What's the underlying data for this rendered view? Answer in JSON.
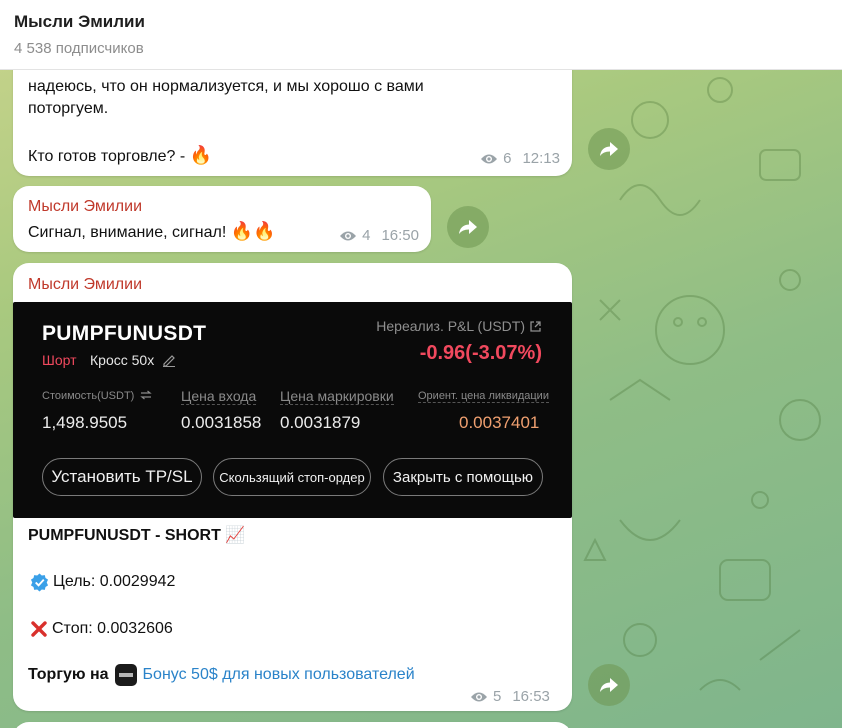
{
  "header": {
    "title": "Мысли Эмилии",
    "subscribers": "4 538 подписчиков"
  },
  "messages": [
    {
      "text_line1": "надеюсь, что он нормализуется, и мы хорошо с вами",
      "text_line2": "поторгуем.",
      "text_line3": "Кто готов торговле? -",
      "emoji": "🔥",
      "views": "6",
      "time": "12:13"
    },
    {
      "sender": "Мысли Эмилии",
      "text": "Сигнал, внимание, сигнал!",
      "emoji": "🔥🔥",
      "views": "4",
      "time": "16:50"
    },
    {
      "sender": "Мысли Эмилии",
      "card": {
        "pair": "PUMPFUNUSDT",
        "direction": "Шорт",
        "mode": "Кросс 50x",
        "pnl_label": "Нереализ. P&L (USDT)",
        "pnl_value": "-0.96(-3.07%)",
        "cost_label": "Стоимость(USDT)",
        "cost_value": "1,498.9505",
        "entry_label": "Цена входа",
        "entry_value": "0.0031858",
        "mark_label": "Цена маркировки",
        "mark_value": "0.0031879",
        "liq_label": "Ориент. цена ликвидации",
        "liq_value": "0.0037401",
        "btn_tpsl": "Установить TP/SL",
        "btn_trailing": "Скользящий стоп-ордер",
        "btn_close": "Закрыть с помощью"
      },
      "title_line": "PUMPFUNUSDT - SHORT",
      "title_emoji": "📈",
      "target_label": "Цель: 0.0029942",
      "stop_label": "Стоп: 0.0032606",
      "trade_prefix": "Торгую на",
      "trade_link": "Бонус 50$ для новых пользователей",
      "views": "5",
      "time": "16:53"
    }
  ],
  "colors": {
    "accent_sender": "#c0392b",
    "link": "#2a83c9",
    "short_red": "#f1495e",
    "liquidation_orange": "#f0a070"
  },
  "icons": [
    "eye-icon",
    "share-icon",
    "edit-icon",
    "swap-icon",
    "external-link-icon",
    "check-badge-icon",
    "cross-mark-icon",
    "bybit-logo-icon",
    "chart-up-icon"
  ]
}
